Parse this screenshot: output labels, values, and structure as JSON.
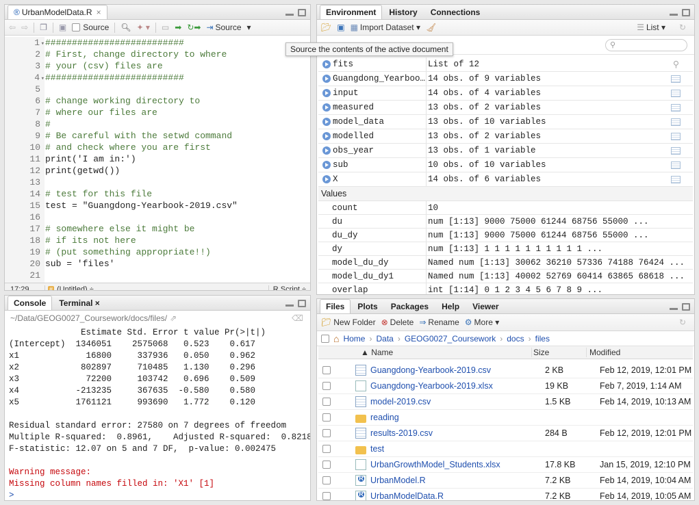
{
  "source_pane": {
    "file_tab": "UrbanModelData.R",
    "toolbar": {
      "source_on_save": "Source",
      "source_btn": "Source"
    },
    "tooltip": "Source the contents of the active document",
    "lines": [
      {
        "n": "1",
        "t": "##########################",
        "c": "cm"
      },
      {
        "n": "2",
        "t": "# First, change directory to where",
        "c": "cm"
      },
      {
        "n": "3",
        "t": "# your (csv) files are",
        "c": "cm"
      },
      {
        "n": "4",
        "t": "##########################",
        "c": "cm"
      },
      {
        "n": "5",
        "t": "",
        "c": ""
      },
      {
        "n": "6",
        "t": "# change working directory to",
        "c": "cm"
      },
      {
        "n": "7",
        "t": "# where our files are",
        "c": "cm"
      },
      {
        "n": "8",
        "t": "#",
        "c": "cm"
      },
      {
        "n": "9",
        "t": "# Be careful with the setwd command",
        "c": "cm"
      },
      {
        "n": "10",
        "t": "# and check where you are first",
        "c": "cm"
      },
      {
        "n": "11",
        "t": "print('I am in:')",
        "c": ""
      },
      {
        "n": "12",
        "t": "print(getwd())",
        "c": ""
      },
      {
        "n": "13",
        "t": "",
        "c": ""
      },
      {
        "n": "14",
        "t": "# test for this file",
        "c": "cm"
      },
      {
        "n": "15",
        "t": "test = \"Guangdong-Yearbook-2019.csv\"",
        "c": ""
      },
      {
        "n": "16",
        "t": "",
        "c": ""
      },
      {
        "n": "17",
        "t": "# somewhere else it might be",
        "c": "cm"
      },
      {
        "n": "18",
        "t": "# if its not here",
        "c": "cm"
      },
      {
        "n": "19",
        "t": "# (put something appropriate!!)",
        "c": "cm"
      },
      {
        "n": "20",
        "t": "sub = 'files'",
        "c": ""
      },
      {
        "n": "21",
        "t": "",
        "c": ""
      }
    ],
    "status": {
      "position": "17:29",
      "scope": "(Untitled) ÷",
      "filetype": "R Script ÷"
    }
  },
  "console_pane": {
    "tabs": [
      "Console",
      "Terminal ×"
    ],
    "path": "~/Data/GEOG0027_Coursework/docs/files/",
    "output": [
      "              Estimate Std. Error t value Pr(>|t|)",
      "(Intercept)  1346051    2575068   0.523    0.617",
      "x1             16800     337936   0.050    0.962",
      "x2            802897     710485   1.130    0.296",
      "x3             72200     103742   0.696    0.509",
      "x4           -213235     367635  -0.580    0.580",
      "x5           1761121     993690   1.772    0.120",
      "",
      "Residual standard error: 27580 on 7 degrees of freedom",
      "Multiple R-squared:  0.8961,    Adjusted R-squared:  0.8218",
      "F-statistic: 12.07 on 5 and 7 DF,  p-value: 0.002475",
      ""
    ],
    "warning": [
      "Warning message:",
      "Missing column names filled in: 'X1' [1]"
    ],
    "prompt": ">"
  },
  "env_pane": {
    "tabs": [
      "Environment",
      "History",
      "Connections"
    ],
    "toolbar": {
      "import": "Import Dataset ▾",
      "view": "List ▾"
    },
    "data_rows": [
      {
        "name": "fits",
        "value": "List of 12"
      },
      {
        "name": "Guangdong_Yearboo…",
        "value": "14 obs. of 9 variables"
      },
      {
        "name": "input",
        "value": "14 obs. of 4 variables"
      },
      {
        "name": "measured",
        "value": "13 obs. of 2 variables"
      },
      {
        "name": "model_data",
        "value": "13 obs. of 10 variables"
      },
      {
        "name": "modelled",
        "value": "13 obs. of 2 variables"
      },
      {
        "name": "obs_year",
        "value": "13 obs. of 1 variable"
      },
      {
        "name": "sub",
        "value": "10 obs. of 10 variables"
      },
      {
        "name": "X",
        "value": "14 obs. of 6 variables"
      }
    ],
    "values_header": "Values",
    "value_rows": [
      {
        "name": "count",
        "value": "10"
      },
      {
        "name": "du",
        "value": "num [1:13] 9000 75000 61244 68756 55000 ..."
      },
      {
        "name": "du_dy",
        "value": "num [1:13] 9000 75000 61244 68756 55000 ..."
      },
      {
        "name": "dy",
        "value": "num [1:13] 1 1 1 1 1 1 1 1 1 1 ..."
      },
      {
        "name": "model_du_dy",
        "value": "Named num [1:13] 30062 36210 57336 74188 76424 ..."
      },
      {
        "name": "model_du_dy1",
        "value": "Named num [1:13] 40002 52769 60414 63865 68618 ..."
      },
      {
        "name": "overlap",
        "value": "int [1:14] 0 1 2 3 4 5 6 7 8 9 ..."
      }
    ]
  },
  "files_pane": {
    "tabs": [
      "Files",
      "Plots",
      "Packages",
      "Help",
      "Viewer"
    ],
    "toolbar": {
      "new_folder": "New Folder",
      "delete": "Delete",
      "rename": "Rename",
      "more": "More ▾"
    },
    "breadcrumb": [
      "Home",
      "Data",
      "GEOG0027_Coursework",
      "docs",
      "files"
    ],
    "columns": {
      "name": "▲ Name",
      "size": "Size",
      "modified": "Modified"
    },
    "rows": [
      {
        "icon": "grid",
        "name": "Guangdong-Yearbook-2019.csv",
        "size": "2 KB",
        "modified": "Feb 12, 2019, 12:01 PM"
      },
      {
        "icon": "doc",
        "name": "Guangdong-Yearbook-2019.xlsx",
        "size": "19 KB",
        "modified": "Feb 7, 2019, 1:14 AM"
      },
      {
        "icon": "grid",
        "name": "model-2019.csv",
        "size": "1.5 KB",
        "modified": "Feb 14, 2019, 10:13 AM"
      },
      {
        "icon": "folder",
        "name": "reading",
        "size": "",
        "modified": ""
      },
      {
        "icon": "grid",
        "name": "results-2019.csv",
        "size": "284 B",
        "modified": "Feb 12, 2019, 12:01 PM"
      },
      {
        "icon": "folder",
        "name": "test",
        "size": "",
        "modified": ""
      },
      {
        "icon": "doc",
        "name": "UrbanGrowthModel_Students.xlsx",
        "size": "17.8 KB",
        "modified": "Jan 15, 2019, 12:10 PM"
      },
      {
        "icon": "r",
        "name": "UrbanModel.R",
        "size": "7.2 KB",
        "modified": "Feb 14, 2019, 10:04 AM"
      },
      {
        "icon": "r",
        "name": "UrbanModelData.R",
        "size": "7.2 KB",
        "modified": "Feb 14, 2019, 10:05 AM"
      }
    ]
  }
}
